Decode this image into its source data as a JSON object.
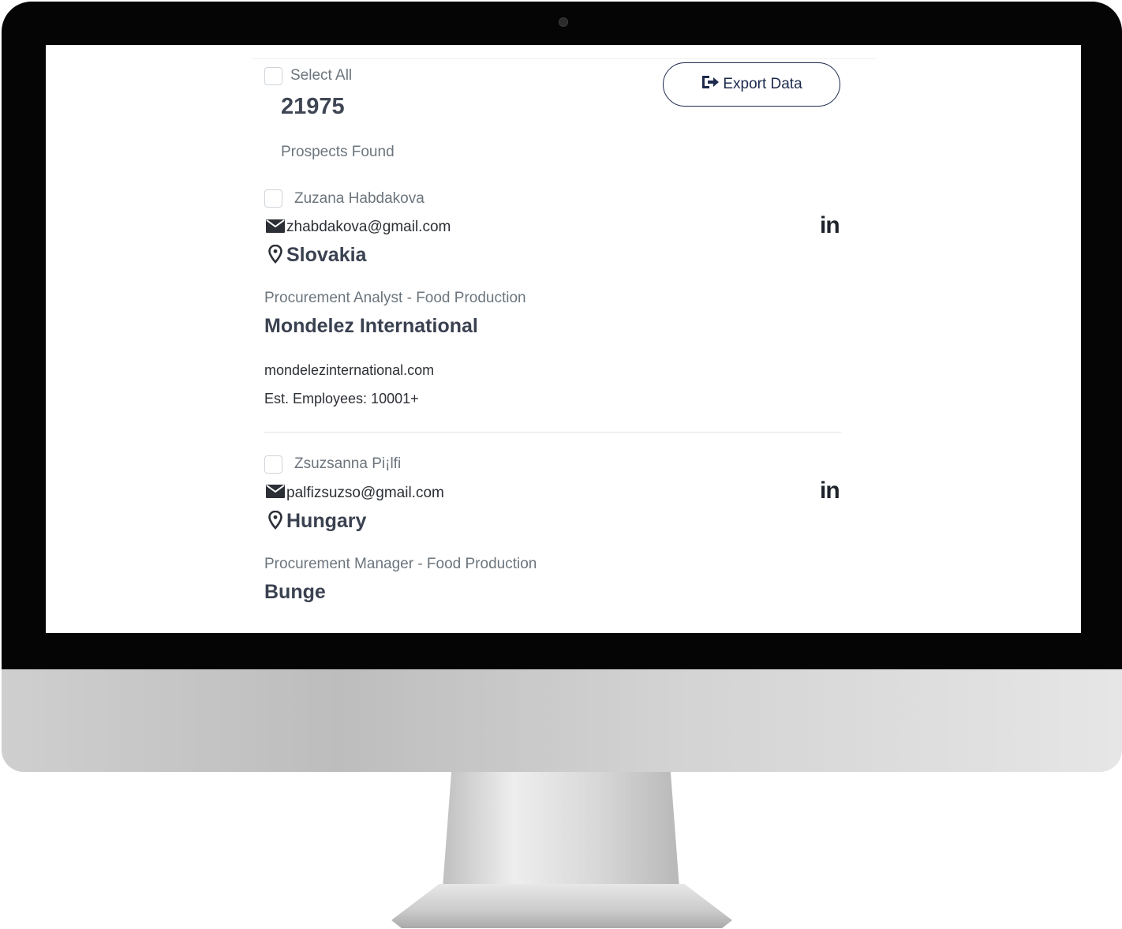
{
  "header": {
    "select_all_label": "Select All",
    "count": "21975",
    "count_caption": "Prospects Found",
    "export_label": "Export Data",
    "export_icon": "sign-out-icon"
  },
  "prospects": [
    {
      "name": "Zuzana Habdakova",
      "email": "zhabdakova@gmail.com",
      "country": "Slovakia",
      "job_title": "Procurement Analyst - Food Production",
      "company": "Mondelez International",
      "website": "mondelezinternational.com",
      "employees": "Est. Employees: 10001+",
      "linkedin_label": "in"
    },
    {
      "name": "Zsuzsanna Pi¡lfi",
      "email": "palfizsuzso@gmail.com",
      "country": "Hungary",
      "job_title": "Procurement Manager - Food Production",
      "company": "Bunge",
      "linkedin_label": "in"
    }
  ],
  "colors": {
    "accent": "#1d2a4d",
    "muted_text": "#6c757d",
    "heading_text": "#3a4150"
  }
}
